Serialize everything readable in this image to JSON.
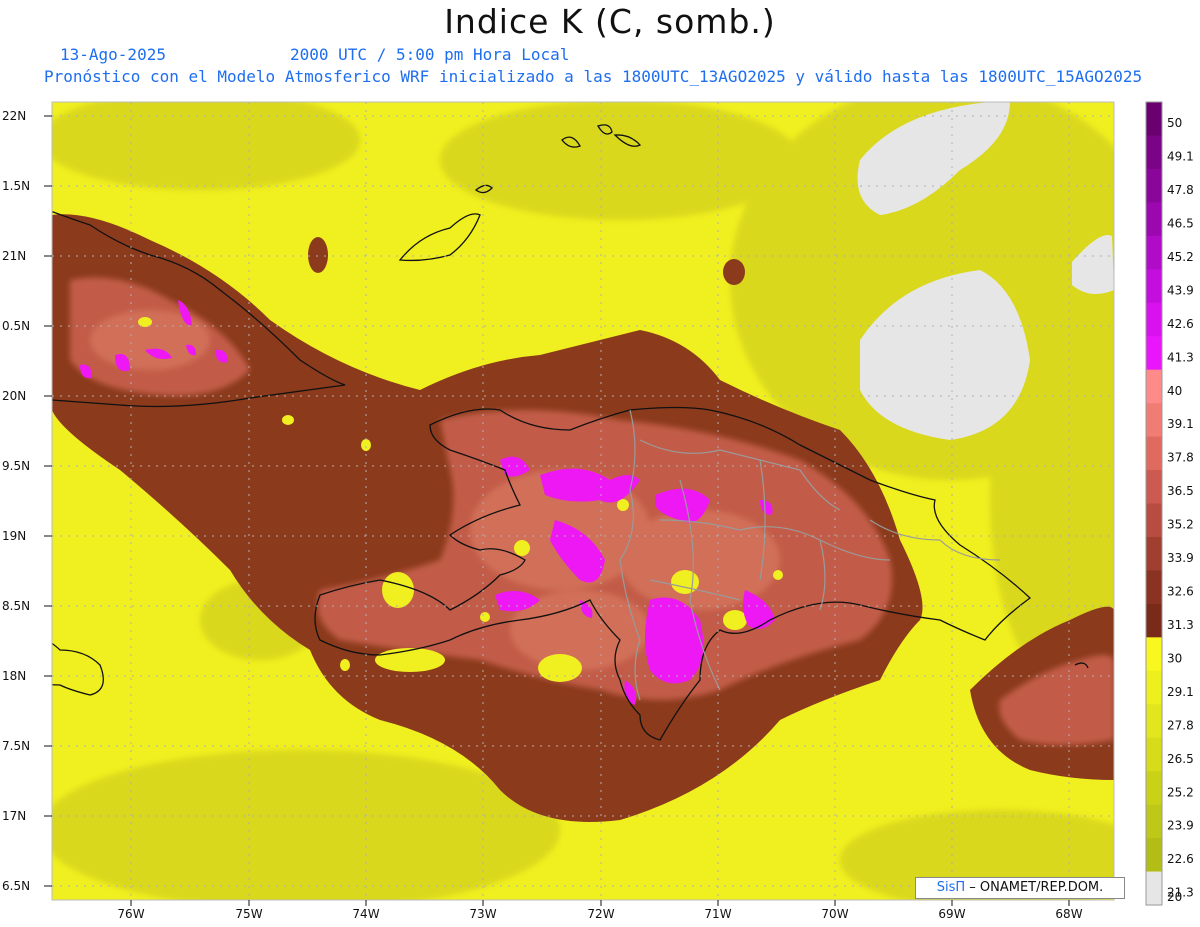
{
  "header": {
    "title": "Indice K (C, somb.)",
    "date": "13-Ago-2025",
    "time": "2000 UTC / 5:00 pm Hora Local",
    "description": "Pronóstico con el Modelo Atmosferico WRF inicializado a las 1800UTC_13AGO2025 y válido hasta las  1800UTC_15AGO2025"
  },
  "axes": {
    "y_labels": [
      "22N",
      "1.5N",
      "21N",
      "0.5N",
      "20N",
      "9.5N",
      "19N",
      "8.5N",
      "18N",
      "7.5N",
      "17N",
      "6.5N"
    ],
    "x_labels": [
      "76W",
      "75W",
      "74W",
      "73W",
      "72W",
      "71W",
      "70W",
      "69W",
      "68W"
    ]
  },
  "colorbar": {
    "labels": [
      "50",
      "49.1",
      "47.8",
      "46.5",
      "45.2",
      "43.9",
      "42.6",
      "41.3",
      "40",
      "39.1",
      "37.8",
      "36.5",
      "35.2",
      "33.9",
      "32.6",
      "31.3",
      "30",
      "29.1",
      "27.8",
      "26.5",
      "25.2",
      "23.9",
      "22.6",
      "21.3",
      "20"
    ],
    "colors": [
      "#6a006f",
      "#7a0485",
      "#8a069a",
      "#9c08b0",
      "#b00cc8",
      "#c40ede",
      "#d812ef",
      "#ea16fb",
      "#ff8a8a",
      "#f07c74",
      "#e06a60",
      "#cc5a50",
      "#b84c40",
      "#a03e30",
      "#8a3322",
      "#7a2a18",
      "#f8f820",
      "#eef01e",
      "#e2e61c",
      "#d6dc1a",
      "#cad218",
      "#bec818",
      "#b2be16",
      "#e6e6e6"
    ]
  },
  "credit": {
    "brand": "SisΠ",
    "text": "– ONAMET/REP.DOM."
  },
  "colors": {
    "title_text": "#111111",
    "subtitle_text": "#1e6ef0",
    "low_yellow": "#f8f820",
    "brown": "#8b3a1c",
    "salmon": "#c8614e",
    "magenta": "#ee18f5",
    "gray": "#e6e6e6"
  }
}
